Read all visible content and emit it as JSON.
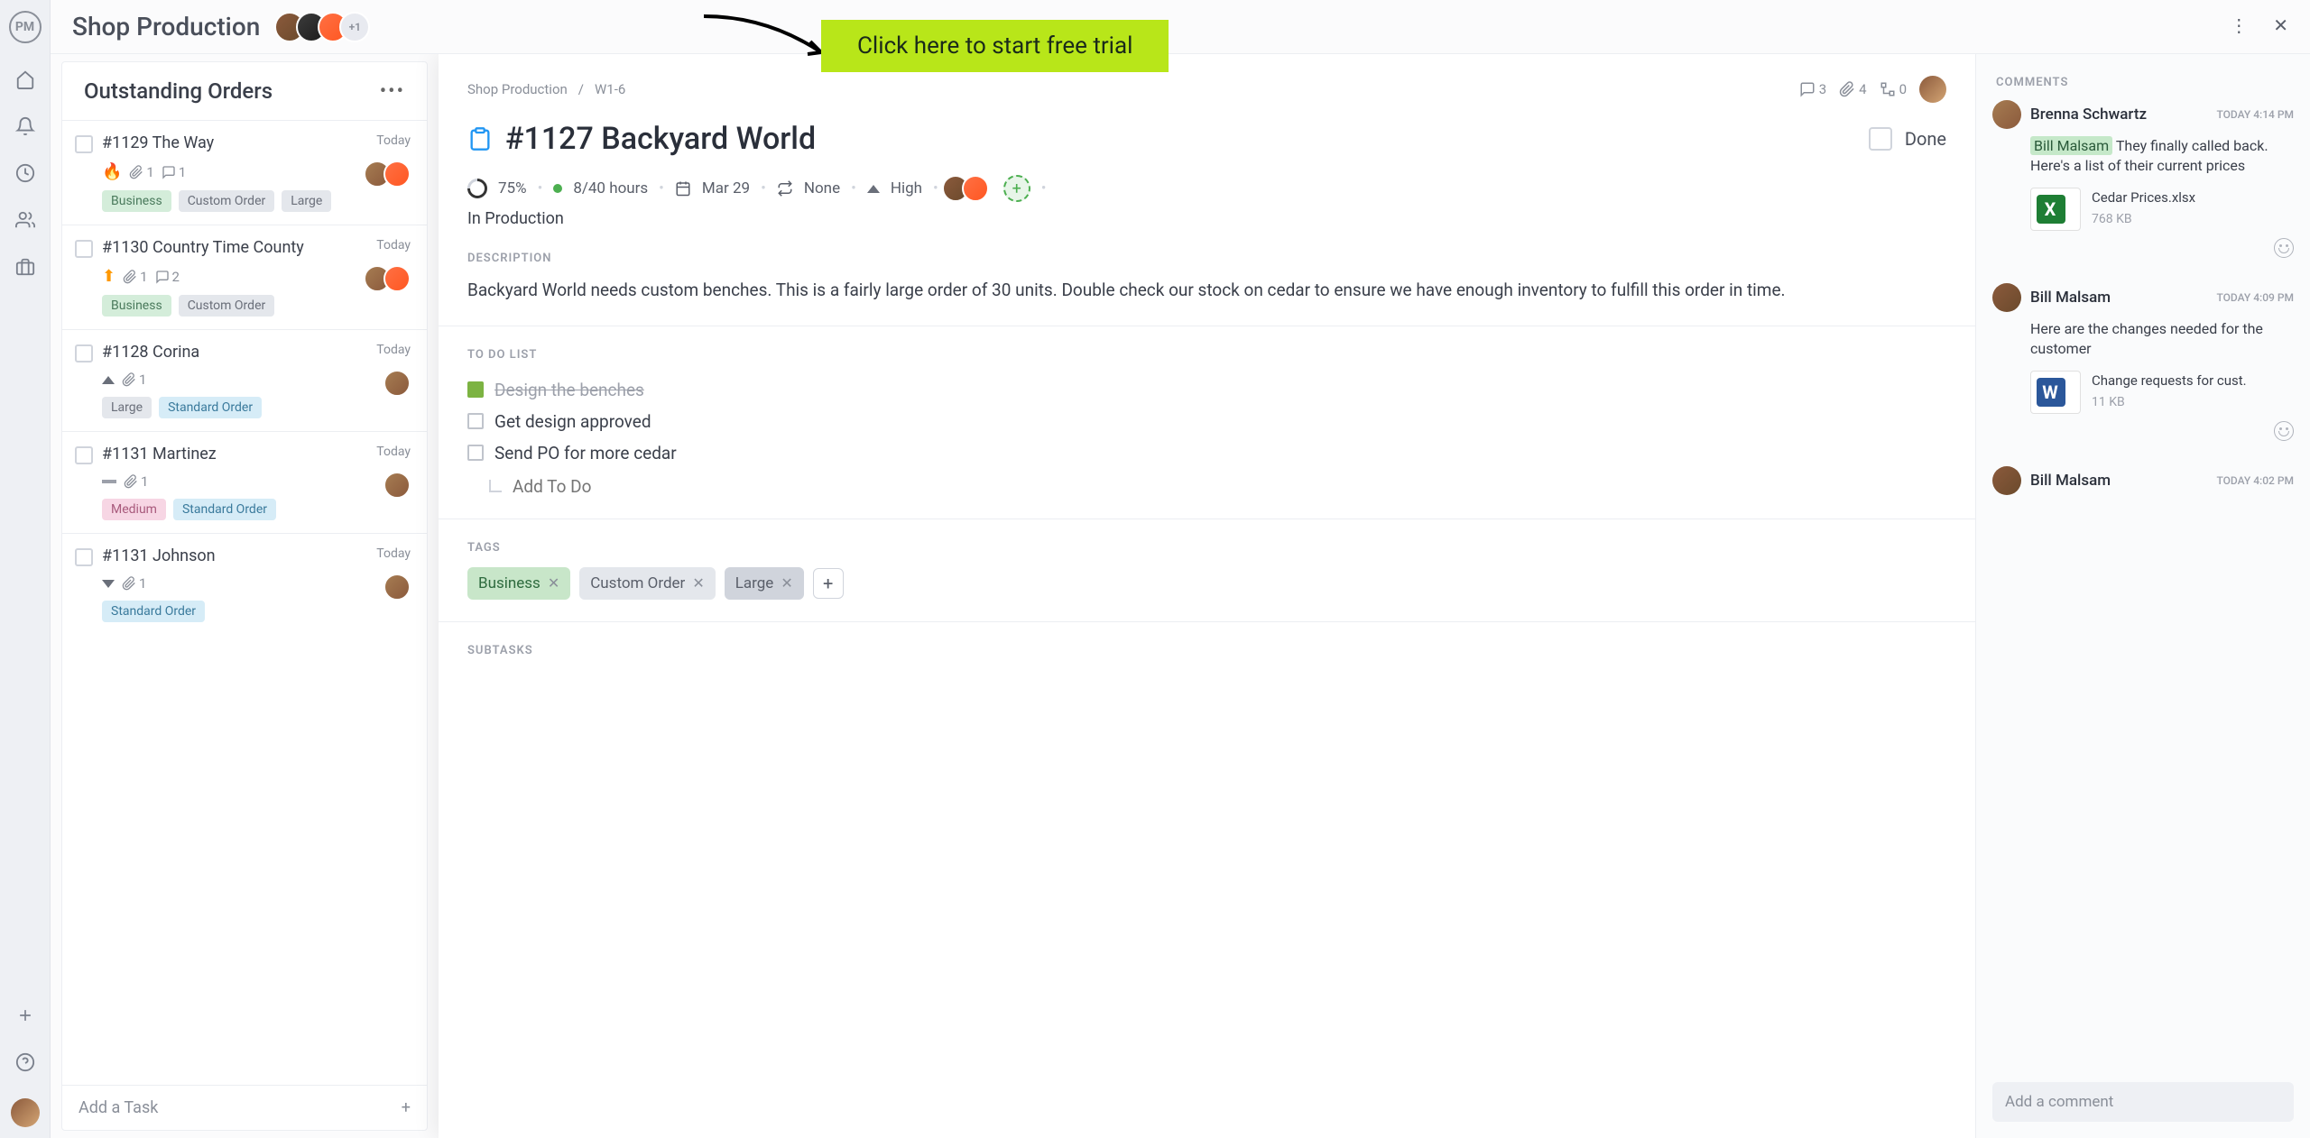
{
  "project_title": "Shop Production",
  "avatar_overflow": "+1",
  "cta_text": "Click here to start free trial",
  "column1": {
    "title": "Outstanding Orders",
    "add_task": "Add a Task"
  },
  "cards": [
    {
      "title": "#1129 The Way",
      "date": "Today",
      "attach": "1",
      "comments": "1",
      "tags": [
        "Business",
        "Custom Order",
        "Large"
      ],
      "priority": "flame"
    },
    {
      "title": "#1130 Country Time County",
      "date": "Today",
      "attach": "1",
      "comments": "2",
      "tags": [
        "Business",
        "Custom Order"
      ],
      "priority": "up"
    },
    {
      "title": "#1128 Corina",
      "date": "Today",
      "attach": "1",
      "comments": "",
      "tags": [
        "Large",
        "Standard Order"
      ],
      "priority": "tri-up"
    },
    {
      "title": "#1131 Martinez",
      "date": "Today",
      "attach": "1",
      "comments": "",
      "tags": [
        "Medium",
        "Standard Order"
      ],
      "priority": "dash"
    },
    {
      "title": "#1131 Johnson",
      "date": "Today",
      "attach": "1",
      "comments": "",
      "tags": [
        "Standard Order"
      ],
      "priority": "tri-down"
    }
  ],
  "column2": {
    "title_partial": "I",
    "add_partial": "Ad"
  },
  "detail": {
    "breadcrumb_project": "Shop Production",
    "breadcrumb_sep": "/",
    "breadcrumb_code": "W1-6",
    "stat_comments": "3",
    "stat_attach": "4",
    "stat_sub": "0",
    "title": "#1127 Backyard World",
    "done_label": "Done",
    "progress": "75%",
    "hours": "8/40 hours",
    "date": "Mar 29",
    "recur": "None",
    "priority": "High",
    "status": "In Production",
    "desc_label": "DESCRIPTION",
    "description": "Backyard World needs custom benches. This is a fairly large order of 30 units. Double check our stock on cedar to ensure we have enough inventory to fulfill this order in time.",
    "todo_label": "TO DO LIST",
    "todos": [
      {
        "text": "Design the benches",
        "done": true
      },
      {
        "text": "Get design approved",
        "done": false
      },
      {
        "text": "Send PO for more cedar",
        "done": false
      }
    ],
    "add_todo_placeholder": "Add To Do",
    "tags_label": "TAGS",
    "tags": [
      "Business",
      "Custom Order",
      "Large"
    ],
    "subtasks_label": "SUBTASKS"
  },
  "comments": {
    "header": "COMMENTS",
    "input_placeholder": "Add a comment",
    "items": [
      {
        "author": "Brenna Schwartz",
        "time": "TODAY 4:14 PM",
        "mention": "Bill Malsam",
        "body_rest": " They finally called back. Here's a list of their current prices",
        "att_name": "Cedar Prices.xlsx",
        "att_size": "768 KB",
        "att_type": "X"
      },
      {
        "author": "Bill Malsam",
        "time": "TODAY 4:09 PM",
        "body": "Here are the changes needed for the customer",
        "att_name": "Change requests for cust.",
        "att_size": "11 KB",
        "att_type": "W"
      },
      {
        "author": "Bill Malsam",
        "time": "TODAY 4:02 PM"
      }
    ]
  }
}
